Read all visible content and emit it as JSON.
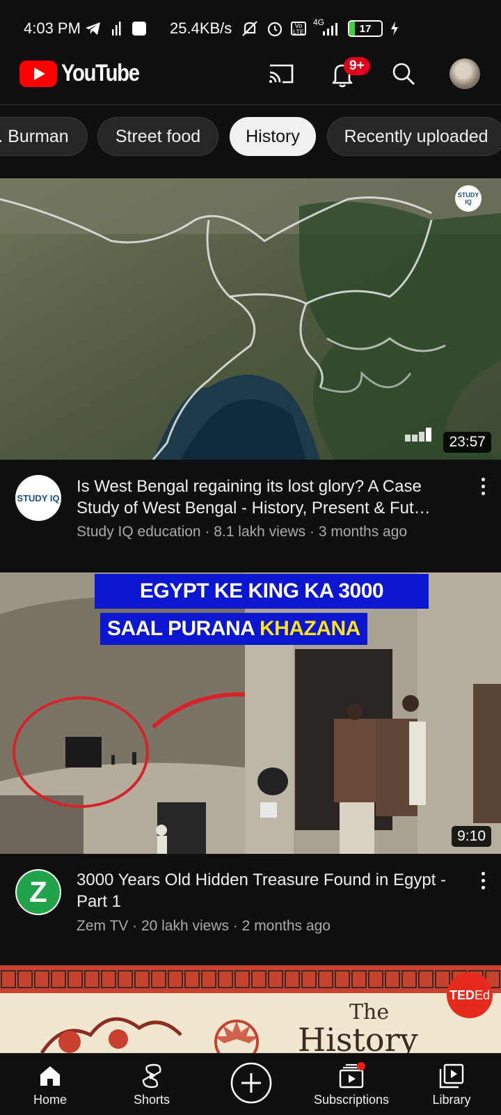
{
  "status_bar": {
    "time": "4:03 PM",
    "speed": "25.4KB/s",
    "network": "4G",
    "battery": "17",
    "battery_level": 0.17
  },
  "header": {
    "logo_text": "YouTube",
    "notifications_badge": "9+"
  },
  "chips": [
    {
      "label": ". Burman"
    },
    {
      "label": "Street food"
    },
    {
      "label": "History",
      "selected": true
    },
    {
      "label": "Recently uploaded"
    }
  ],
  "videos": [
    {
      "title": "Is West Bengal regaining its lost glory? A Case Study of West Bengal - History, Present & Fut…",
      "meta": "Study IQ education · 8.1 lakh views · 3 months ago",
      "duration": "23:57",
      "channel_logo_text": "STUDY IQ",
      "thumbnail_watermark": "STUDY IQ"
    },
    {
      "title": "3000 Years Old Hidden Treasure Found in Egypt - Part 1",
      "meta": "Zem TV · 20 lakh views · 2 months ago",
      "duration": "9:10",
      "channel_logo_text": "Z",
      "thumb_line1": "EGYPT KE KING KA 3000",
      "thumb_line2_a": "SAAL PURANA ",
      "thumb_line2_b": "KHAZANA"
    },
    {
      "thumb_title_1": "The",
      "thumb_title_2": "History",
      "badge_text": "TED",
      "badge_text_b": "Ed"
    }
  ],
  "bottom_nav": {
    "home": "Home",
    "shorts": "Shorts",
    "subscriptions": "Subscriptions",
    "library": "Library"
  },
  "colors": {
    "background": "#0f0f0f",
    "brand_red": "#ff0000",
    "chip_bg": "#272727",
    "chip_active_bg": "#f1f1f1",
    "secondary_text": "#aaaaaa"
  }
}
